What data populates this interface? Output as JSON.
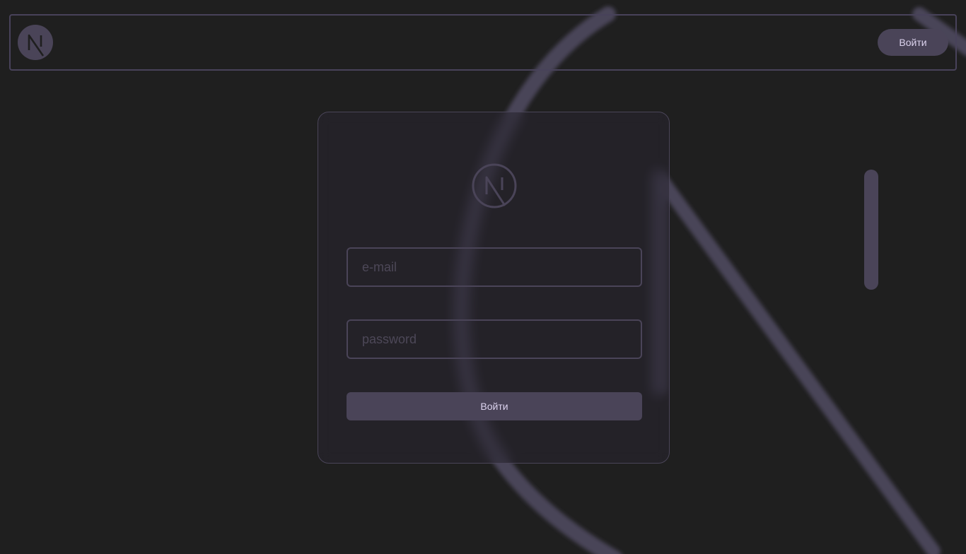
{
  "header": {
    "logo_icon": "nextjs-logo-icon",
    "login_label": "Войти"
  },
  "login_card": {
    "logo_icon": "nextjs-logo-icon",
    "email": {
      "placeholder": "e-mail",
      "value": ""
    },
    "password": {
      "placeholder": "password",
      "value": ""
    },
    "submit_label": "Войти"
  },
  "background": {
    "decoration_icon": "nextjs-logo-icon"
  },
  "colors": {
    "page_background": "#1f1f1f",
    "accent": "#4a4458",
    "accent_text": "#dcd3ee",
    "border": "#48425a"
  }
}
